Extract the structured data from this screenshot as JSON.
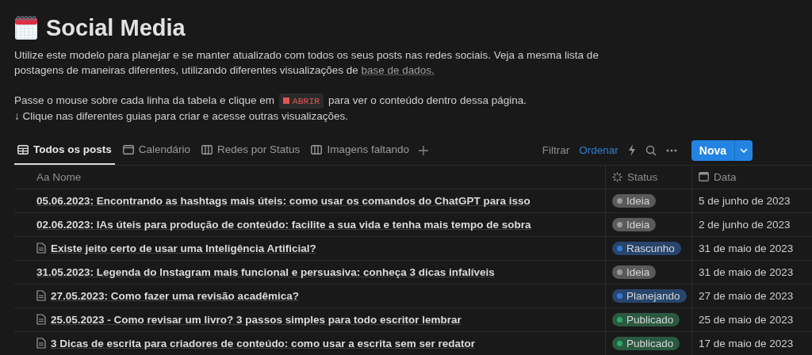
{
  "page": {
    "title": "Social Media",
    "description": {
      "text": "Utilize este modelo para planejar e se manter atualizado com todos os seus posts nas redes sociais. Veja a mesma lista de postagens de maneiras diferentes, utilizando diferentes visualizações de ",
      "link": "base de dados."
    },
    "hint": {
      "before": "Passe o mouse sobre cada linha da tabela e clique em",
      "code": "ABRIR",
      "after": "para ver o conteúdo dentro dessa página."
    },
    "hint2": "↓ Clique nas diferentes guias para criar e acesse outras visualizações."
  },
  "tabs": [
    {
      "label": "Todos os posts",
      "kind": "table",
      "selected": true
    },
    {
      "label": "Calendário",
      "kind": "calendar",
      "selected": false
    },
    {
      "label": "Redes por Status",
      "kind": "board",
      "selected": false
    },
    {
      "label": "Imagens faltando",
      "kind": "board",
      "selected": false
    }
  ],
  "toolbar": {
    "filter": "Filtrar",
    "sort": "Ordenar",
    "sort_active": true,
    "new_button": "Nova"
  },
  "table": {
    "columns": [
      {
        "label": "Aa Nome",
        "kind": "title"
      },
      {
        "label": "Status",
        "kind": "status"
      },
      {
        "label": "Data",
        "kind": "date"
      }
    ],
    "rows": [
      {
        "name": "05.06.2023: Encontrando as hashtags mais úteis: como usar os comandos do ChatGPT para isso",
        "has_page": false,
        "status": "Ideia",
        "color": "#9b9b9b",
        "date": "5 de junho de 2023"
      },
      {
        "name": "02.06.2023: IAs úteis para produção de conteúdo: facilite a sua vida e tenha mais tempo de sobra",
        "has_page": false,
        "status": "Ideia",
        "color": "#9b9b9b",
        "date": "2 de junho de 2023"
      },
      {
        "name": "Existe jeito certo de usar uma Inteligência Artificial?",
        "has_page": true,
        "status": "Rascunho",
        "color": "#2e7dd6",
        "date": "31 de maio de 2023"
      },
      {
        "name": "31.05.2023: Legenda do Instagram mais funcional e persuasiva: conheça 3 dicas infalíveis",
        "has_page": false,
        "status": "Ideia",
        "color": "#9b9b9b",
        "date": "31 de maio de 2023"
      },
      {
        "name": "27.05.2023: Como fazer uma revisão acadêmica?",
        "has_page": true,
        "status": "Planejando",
        "color": "#2e7dd6",
        "date": "27 de maio de 2023"
      },
      {
        "name": "25.05.2023 - Como revisar um livro? 3 passos simples para todo escritor lembrar",
        "has_page": true,
        "status": "Publicado",
        "color": "#2ea86b",
        "date": "25 de maio de 2023"
      },
      {
        "name": "3 Dicas de escrita para criadores de conteúdo: como usar a escrita sem ser redator",
        "has_page": true,
        "status": "Publicado",
        "color": "#2ea86b",
        "date": "17 de maio de 2023"
      }
    ]
  }
}
